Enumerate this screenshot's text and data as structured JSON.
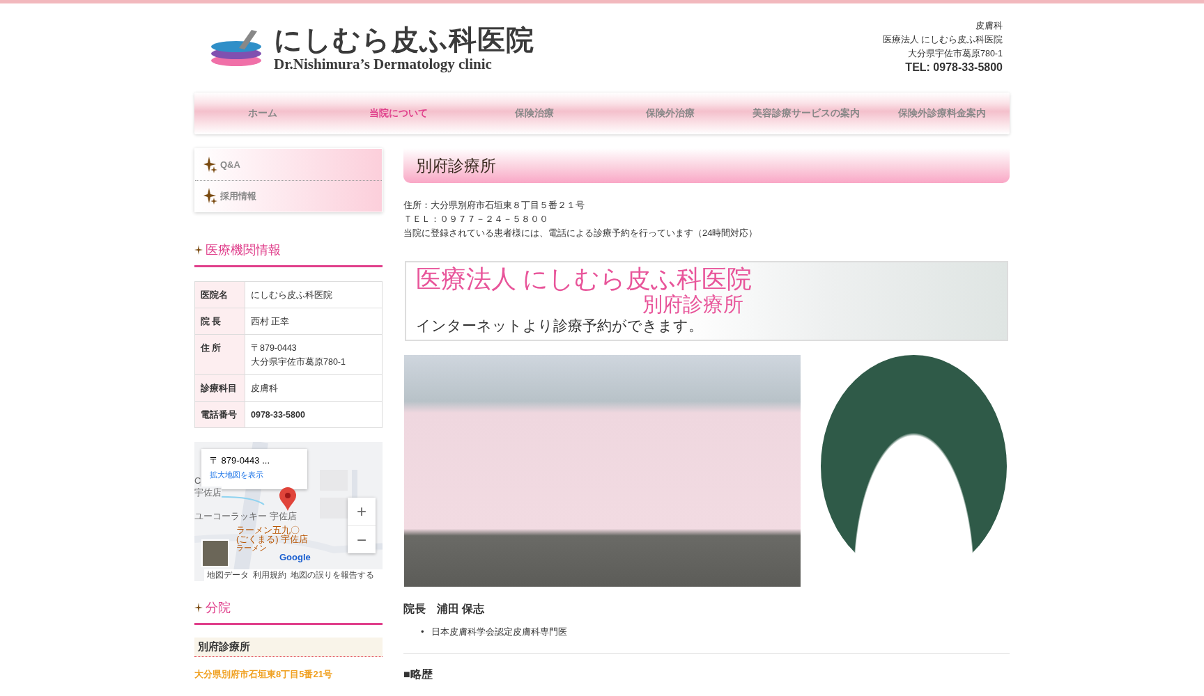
{
  "logo": {
    "title": "にしむら皮ふ科医院",
    "subtitle": "Dr.Nishimura’s Dermatology clinic"
  },
  "top_info": {
    "lines": [
      "皮膚科",
      "医療法人 にしむら皮ふ科医院",
      "大分県宇佐市葛原780-1"
    ],
    "tel": "TEL: 0978-33-5800"
  },
  "nav": [
    {
      "label": "ホーム",
      "selected": false
    },
    {
      "label": "当院について",
      "selected": true
    },
    {
      "label": "保険治療",
      "selected": false
    },
    {
      "label": "保険外治療",
      "selected": false
    },
    {
      "label": "美容診療サービスの案内",
      "selected": false
    },
    {
      "label": "保険外診療料金案内",
      "selected": false
    }
  ],
  "sidebar": {
    "menu": [
      "Q&A",
      "採用情報"
    ],
    "info_heading": "医療機関情報",
    "info_rows": [
      {
        "label": "医院名",
        "kind": "text",
        "values": [
          "にしむら皮ふ科医院"
        ]
      },
      {
        "label": "院 長",
        "kind": "text",
        "values": [
          "西村 正幸"
        ]
      },
      {
        "label": "住 所",
        "kind": "text",
        "values": [
          "〒879-0443",
          "大分県宇佐市葛原780-1"
        ]
      },
      {
        "label": "診療科目",
        "kind": "text",
        "values": [
          "皮膚科"
        ]
      },
      {
        "label": "電話番号",
        "kind": "phone",
        "values": [
          "0978-33-5800"
        ]
      }
    ],
    "map": {
      "card_title": "〒 879-0443 ...",
      "card_link": "拡大地図を表示",
      "labels": [
        "C",
        "宇佐店",
        "ユーコーラッキー 宇佐店"
      ],
      "poi": [
        "ラーメン五九〇",
        "(ごくまる) 宇佐店",
        "ラーメン"
      ],
      "brand": "Google",
      "zoom_in": "+",
      "zoom_out": "−",
      "footer": [
        "地図データ",
        "利用規約",
        "地図の誤りを報告する"
      ]
    },
    "branch_heading": "分院",
    "branch_name": "別府診療所",
    "branch_address": "大分県別府市石垣東8丁目5番21号"
  },
  "main": {
    "title": "別府診療所",
    "lines": [
      "住所：大分県別府市石垣東８丁目５番２１号",
      "ＴＥＬ：０９７７－２４－５８００",
      "当院に登録されている患者様には、電話による診療予約を行っています（24時間対応）"
    ],
    "banner": {
      "line1": "医療法人 にしむら皮ふ科医院",
      "line2": "別府診療所",
      "line3": "インターネットより診療予約ができます。"
    },
    "director": "院長　浦田 保志",
    "list_marker": "•",
    "qualifications": [
      "日本皮膚科学会認定皮膚科専門医"
    ],
    "history_heading": "■略歴"
  }
}
